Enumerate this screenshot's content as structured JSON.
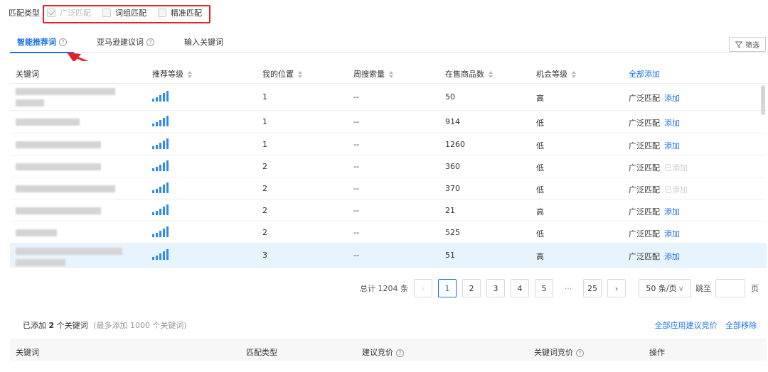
{
  "match": {
    "label": "匹配类型",
    "options": [
      {
        "label": "广泛匹配",
        "checked": true,
        "disabled": true
      },
      {
        "label": "词组匹配",
        "checked": false,
        "disabled": false
      },
      {
        "label": "精准匹配",
        "checked": false,
        "disabled": false
      }
    ]
  },
  "tabs": [
    {
      "label": "智能推荐词",
      "active": true
    },
    {
      "label": "亚马逊建议词",
      "active": false
    },
    {
      "label": "输入关键词",
      "active": false
    }
  ],
  "filter_label": "筛选",
  "table": {
    "headers": {
      "keyword": "关键词",
      "level": "推荐等级",
      "position": "我的位置",
      "weekly": "周搜索量",
      "products": "在售商品数",
      "opportunity": "机会等级",
      "add_all": "全部添加"
    },
    "rows": [
      {
        "position": "1",
        "weekly": "--",
        "products": "50",
        "opportunity": "高",
        "match": "广泛匹配",
        "action": "添加",
        "added": false
      },
      {
        "position": "1",
        "weekly": "--",
        "products": "914",
        "opportunity": "低",
        "match": "广泛匹配",
        "action": "添加",
        "added": false
      },
      {
        "position": "1",
        "weekly": "--",
        "products": "1260",
        "opportunity": "低",
        "match": "广泛匹配",
        "action": "添加",
        "added": false
      },
      {
        "position": "2",
        "weekly": "--",
        "products": "360",
        "opportunity": "低",
        "match": "广泛匹配",
        "action": "已添加",
        "added": true
      },
      {
        "position": "2",
        "weekly": "--",
        "products": "370",
        "opportunity": "低",
        "match": "广泛匹配",
        "action": "已添加",
        "added": true
      },
      {
        "position": "2",
        "weekly": "--",
        "products": "21",
        "opportunity": "高",
        "match": "广泛匹配",
        "action": "添加",
        "added": false
      },
      {
        "position": "2",
        "weekly": "--",
        "products": "525",
        "opportunity": "低",
        "match": "广泛匹配",
        "action": "添加",
        "added": false
      },
      {
        "position": "3",
        "weekly": "--",
        "products": "51",
        "opportunity": "高",
        "match": "广泛匹配",
        "action": "添加",
        "added": false
      }
    ]
  },
  "pagination": {
    "total": "总计 1204 条",
    "pages": [
      "1",
      "2",
      "3",
      "4",
      "5",
      "···",
      "25"
    ],
    "current": "1",
    "page_size": "50 条/页",
    "jump_label": "跳至",
    "jump_suffix": "页"
  },
  "added_section": {
    "summary_prefix": "已添加",
    "count": "2",
    "summary_suffix": "个关键词",
    "hint": "(最多添加 1000 个关键词)",
    "apply_all": "全部应用建议竞价",
    "remove_all": "全部移除"
  },
  "bottom_headers": {
    "keyword": "关键词",
    "match_type": "匹配类型",
    "suggested_bid": "建议竞价",
    "keyword_bid": "关键词竞价",
    "action": "操作"
  }
}
